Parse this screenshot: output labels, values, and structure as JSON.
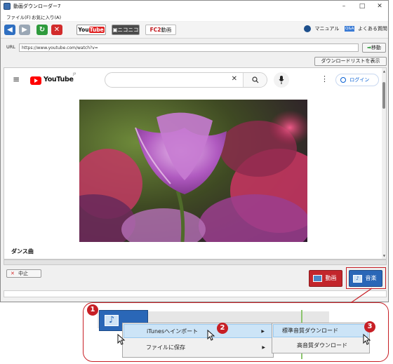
{
  "window": {
    "title": "動画ダウンローダー7",
    "controls": [
      "–",
      "□",
      "✕"
    ]
  },
  "menu": [
    "ファイル(F)",
    "お気に入り(A)"
  ],
  "toolbar": {
    "site_youtube_prefix": "You",
    "site_youtube_suffix": "Tube",
    "site_niconico": "ニコニコ",
    "site_fc2_prefix": "FC2",
    "site_fc2_suffix": "動画",
    "manual_label": "マニュアル",
    "faq_badge": "Q&A",
    "faq_label": "よくある質問"
  },
  "url": {
    "label": "URL",
    "value": "https://www.youtube.com/watch?v=",
    "go_label": "移動"
  },
  "download_list_button": "ダウンロードリストを表示",
  "youtube": {
    "logo_text": "YouTube",
    "logo_sup": "JP",
    "login_label": "ログイン",
    "video_title": "ダンス曲"
  },
  "controls": {
    "stop_label": "中止",
    "video_label": "動画",
    "music_label": "音楽"
  },
  "callout": {
    "menu_itunes": "iTunesへインポート",
    "menu_save_file": "ファイルに保存",
    "submenu_standard": "標準音質ダウンロード",
    "submenu_high": "高音質ダウンロード",
    "steps": [
      "1",
      "2",
      "3"
    ]
  },
  "colors": {
    "accent_red": "#c71f25",
    "youtube_red": "#ff0000",
    "selection_blue": "#cce4f7",
    "link_blue": "#065fd4"
  }
}
